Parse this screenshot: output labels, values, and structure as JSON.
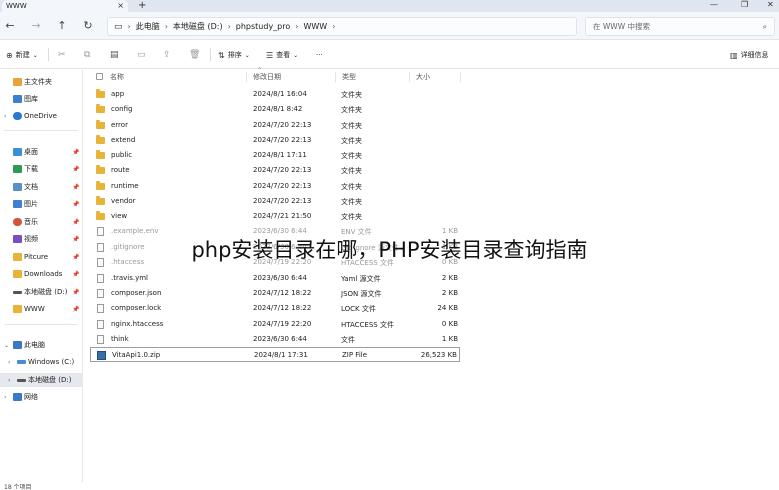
{
  "window": {
    "tab_title": "WWW",
    "new_tab": "+",
    "minimize": "—",
    "maximize": "❐",
    "close": "✕"
  },
  "address": {
    "segments": [
      "此电脑",
      "本地磁盘 (D:)",
      "phpstudy_pro",
      "WWW"
    ],
    "search_placeholder": "在 WWW 中搜索"
  },
  "toolbar": {
    "new_label": "新建",
    "sort_label": "排序",
    "view_label": "查看",
    "more_label": "···",
    "details_label": "详细信息"
  },
  "sidebar": {
    "items": [
      {
        "label": "主文件夹"
      },
      {
        "label": "图库"
      },
      {
        "label": "OneDrive"
      },
      {
        "label": "桌面"
      },
      {
        "label": "下载"
      },
      {
        "label": "文档"
      },
      {
        "label": "图片"
      },
      {
        "label": "音乐"
      },
      {
        "label": "视频"
      },
      {
        "label": "Pitcure"
      },
      {
        "label": "Downloads"
      },
      {
        "label": "本地磁盘 (D:)"
      },
      {
        "label": "WWW"
      },
      {
        "label": "此电脑"
      },
      {
        "label": "Windows (C:)"
      },
      {
        "label": "本地磁盘 (D:)"
      },
      {
        "label": "网络"
      }
    ]
  },
  "columns": {
    "name": "名称",
    "date": "修改日期",
    "type": "类型",
    "size": "大小"
  },
  "files": [
    {
      "name": "app",
      "date": "2024/8/1 16:04",
      "type": "文件夹",
      "size": ""
    },
    {
      "name": "config",
      "date": "2024/8/1 8:42",
      "type": "文件夹",
      "size": ""
    },
    {
      "name": "error",
      "date": "2024/7/20 22:13",
      "type": "文件夹",
      "size": ""
    },
    {
      "name": "extend",
      "date": "2024/7/20 22:13",
      "type": "文件夹",
      "size": ""
    },
    {
      "name": "public",
      "date": "2024/8/1 17:11",
      "type": "文件夹",
      "size": ""
    },
    {
      "name": "route",
      "date": "2024/7/20 22:13",
      "type": "文件夹",
      "size": ""
    },
    {
      "name": "runtime",
      "date": "2024/7/20 22:13",
      "type": "文件夹",
      "size": ""
    },
    {
      "name": "vendor",
      "date": "2024/7/20 22:13",
      "type": "文件夹",
      "size": ""
    },
    {
      "name": "view",
      "date": "2024/7/21 21:50",
      "type": "文件夹",
      "size": ""
    },
    {
      "name": ".example.env",
      "date": "2023/6/30 6:44",
      "type": "ENV 文件",
      "size": "1 KB"
    },
    {
      "name": ".gitignore",
      "date": "2023/6/30 6:44",
      "type": "Git Ignore 源文件",
      "size": "1 KB"
    },
    {
      "name": ".htaccess",
      "date": "2024/7/19 22:20",
      "type": "HTACCESS 文件",
      "size": "0 KB"
    },
    {
      "name": ".travis.yml",
      "date": "2023/6/30 6:44",
      "type": "Yaml 源文件",
      "size": "2 KB"
    },
    {
      "name": "composer.json",
      "date": "2024/7/12 18:22",
      "type": "JSON 源文件",
      "size": "2 KB"
    },
    {
      "name": "composer.lock",
      "date": "2024/7/12 18:22",
      "type": "LOCK 文件",
      "size": "24 KB"
    },
    {
      "name": "nginx.htaccess",
      "date": "2024/7/19 22:20",
      "type": "HTACCESS 文件",
      "size": "0 KB"
    },
    {
      "name": "think",
      "date": "2023/6/30 6:44",
      "type": "文件",
      "size": "1 KB"
    },
    {
      "name": "VitaApi1.0.zip",
      "date": "2024/8/1 17:31",
      "type": "ZIP File",
      "size": "26,523 KB"
    }
  ],
  "watermark": "php安装目录在哪，PHP安装目录查询指南",
  "status": {
    "item_count": "18 个项目"
  }
}
